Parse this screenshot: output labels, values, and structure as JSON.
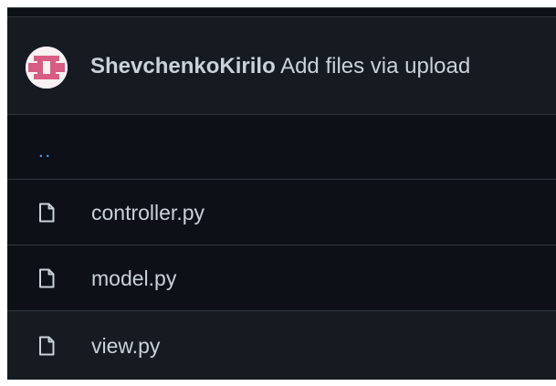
{
  "commit": {
    "author": "ShevchenkoKirilo",
    "message": "Add files via upload"
  },
  "parent_directory": {
    "label": ".."
  },
  "files": [
    {
      "name": "controller.py",
      "icon": "file-icon"
    },
    {
      "name": "model.py",
      "icon": "file-icon"
    },
    {
      "name": "view.py",
      "icon": "file-icon"
    }
  ],
  "colors": {
    "background": "#0d1117",
    "header_background": "#161b22",
    "border": "#30363d",
    "text": "#c9d1d9",
    "link": "#58a6ff",
    "avatar_pattern": "#d85c84"
  }
}
